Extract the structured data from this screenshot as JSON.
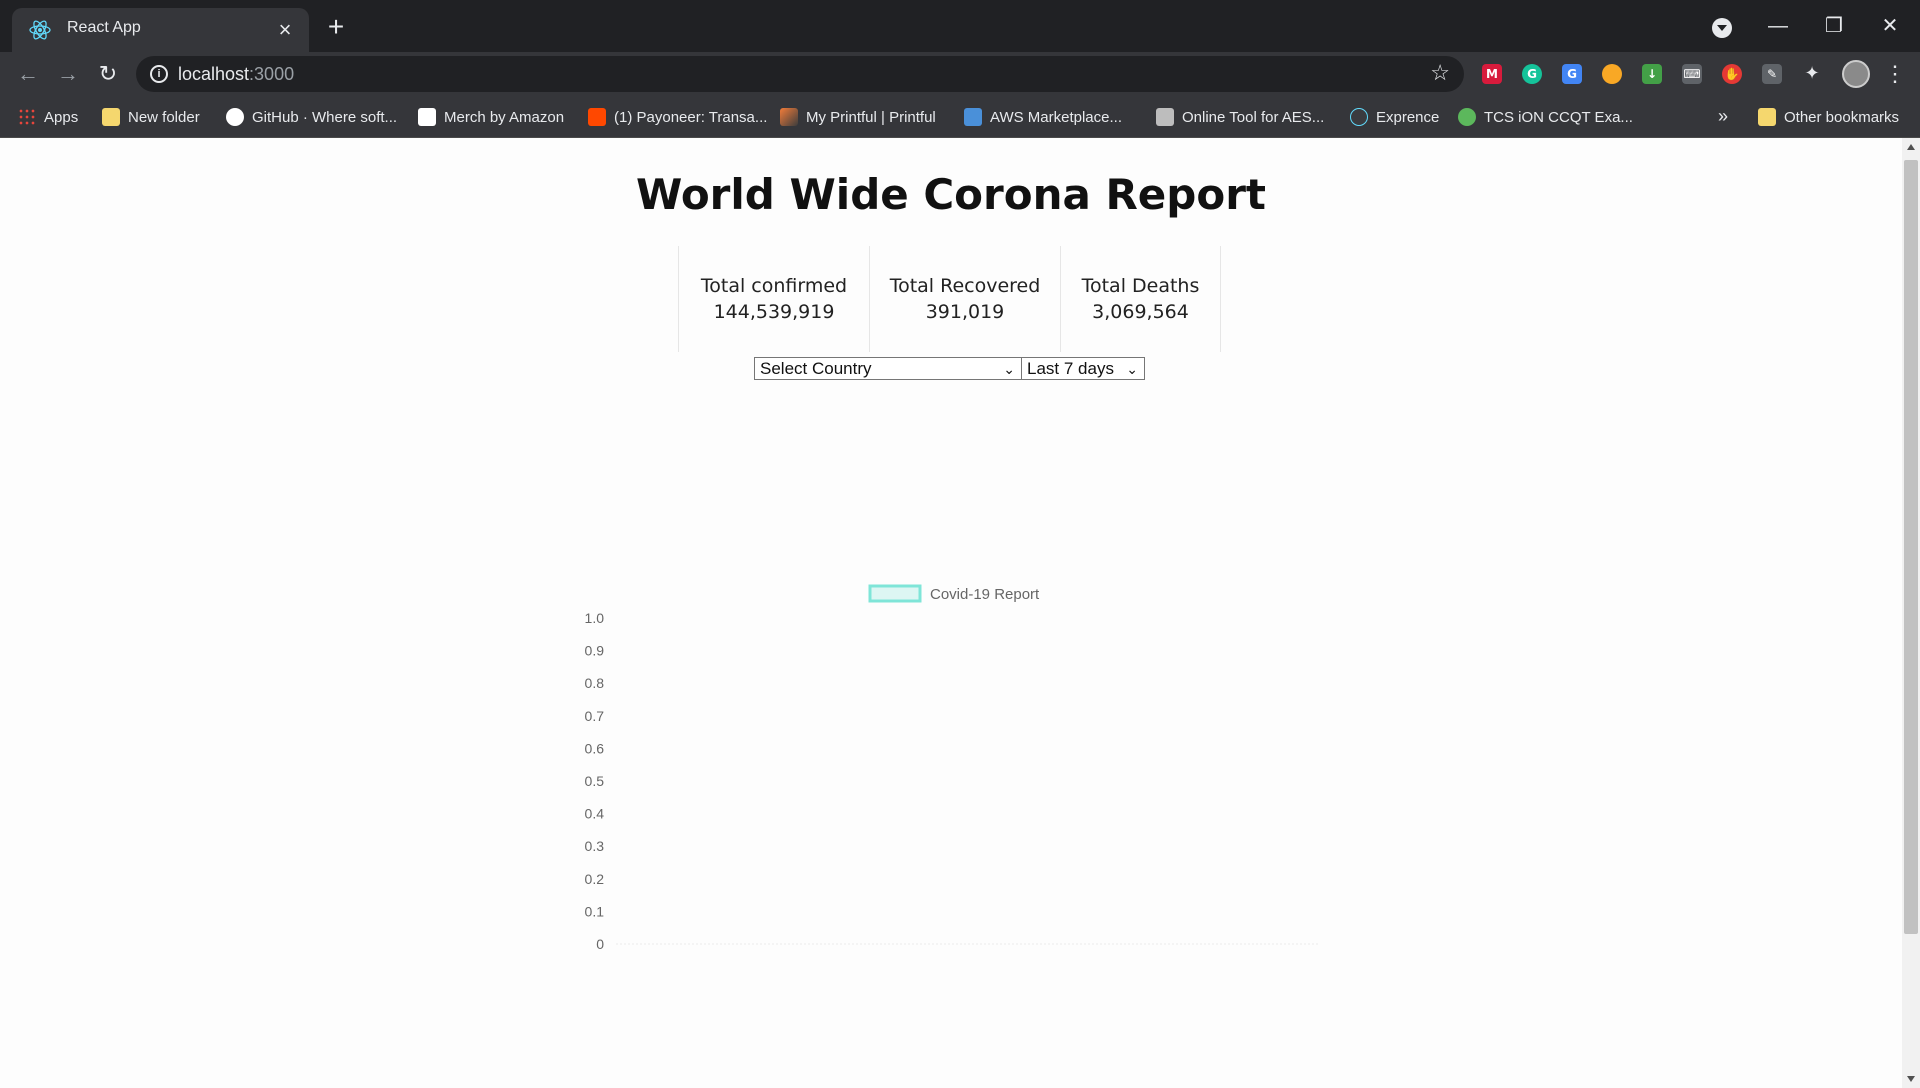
{
  "browser": {
    "tab_title": "React App",
    "url_host": "localhost",
    "url_port": ":3000",
    "new_tab_symbol": "+",
    "bookmarks": [
      {
        "label": "Apps",
        "icon": "apps-grid-icon",
        "color": "#e8453c"
      },
      {
        "label": "New folder",
        "icon": "folder-icon",
        "color": "#f5d76e"
      },
      {
        "label": "GitHub · Where soft...",
        "icon": "github-icon",
        "color": "#ffffff"
      },
      {
        "label": "Merch by Amazon",
        "icon": "amazon-icon",
        "color": "#ffffff"
      },
      {
        "label": "(1) Payoneer: Transa...",
        "icon": "payoneer-icon",
        "color": "#ff4800"
      },
      {
        "label": "My Printful | Printful",
        "icon": "printful-icon",
        "color": "#f27c39"
      },
      {
        "label": "AWS Marketplace...",
        "icon": "aws-icon",
        "color": "#4a90d9"
      },
      {
        "label": "Online Tool for AES...",
        "icon": "code-icon",
        "color": "#bdbdbd"
      },
      {
        "label": "Exprence",
        "icon": "react-icon",
        "color": "#61dafb"
      },
      {
        "label": "TCS iON CCQT Exa...",
        "icon": "tcs-icon",
        "color": "#5cb85c"
      }
    ],
    "more_bookmarks": "»",
    "other_bookmarks": "Other bookmarks"
  },
  "page": {
    "title": "World Wide Corona Report",
    "stats": [
      {
        "label": "Total confirmed",
        "value": "144,539,919"
      },
      {
        "label": "Total Recovered",
        "value": "391,019"
      },
      {
        "label": "Total Deaths",
        "value": "3,069,564"
      }
    ],
    "country_select": {
      "selected": "Select Country"
    },
    "range_select": {
      "selected": "Last 7 days"
    }
  },
  "chart_data": {
    "type": "line",
    "legend": [
      {
        "name": "Covid-19 Report",
        "color": "#7fe5d8"
      }
    ],
    "y_ticks": [
      "1.0",
      "0.9",
      "0.8",
      "0.7",
      "0.6",
      "0.5",
      "0.4",
      "0.3",
      "0.2",
      "0.1",
      "0"
    ],
    "ylim": [
      0,
      1
    ],
    "categories": [],
    "series": [
      {
        "name": "Covid-19 Report",
        "values": []
      }
    ],
    "grid": false
  }
}
